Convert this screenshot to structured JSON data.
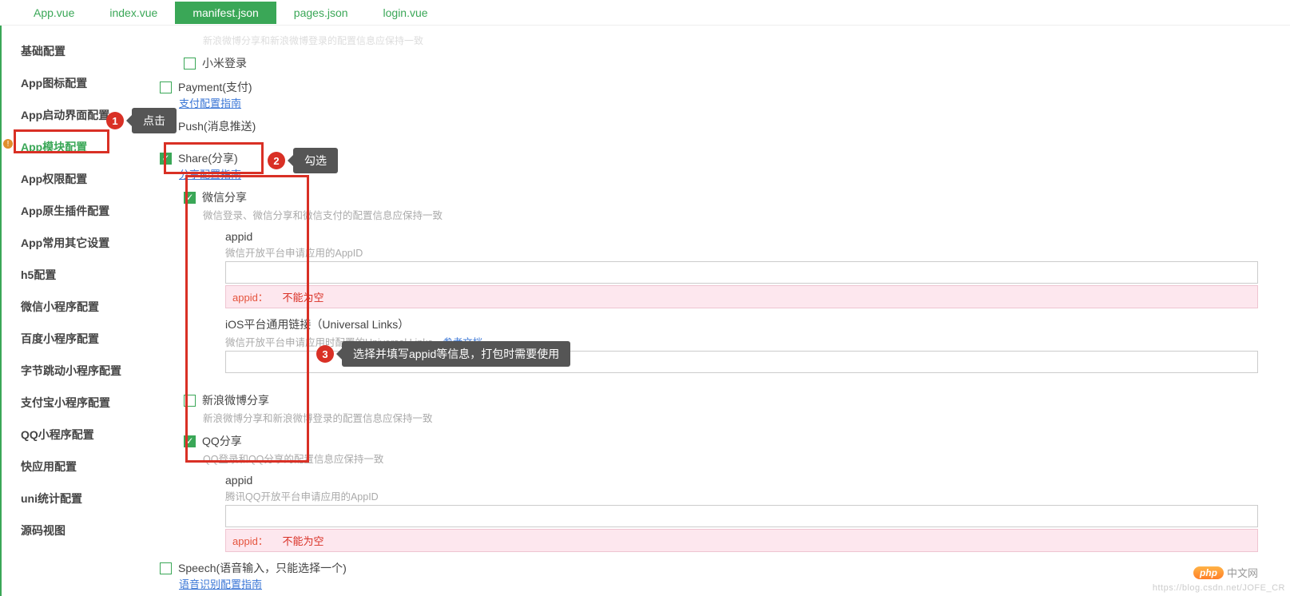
{
  "tabs": [
    {
      "label": "App.vue"
    },
    {
      "label": "index.vue"
    },
    {
      "label": "manifest.json",
      "active": true
    },
    {
      "label": "pages.json"
    },
    {
      "label": "login.vue"
    }
  ],
  "sidebar": {
    "items": [
      {
        "label": "基础配置"
      },
      {
        "label": "App图标配置"
      },
      {
        "label": "App启动界面配置"
      },
      {
        "label": "App模块配置",
        "active": true
      },
      {
        "label": "App权限配置"
      },
      {
        "label": "App原生插件配置"
      },
      {
        "label": "App常用其它设置"
      },
      {
        "label": "h5配置"
      },
      {
        "label": "微信小程序配置"
      },
      {
        "label": "百度小程序配置"
      },
      {
        "label": "字节跳动小程序配置"
      },
      {
        "label": "支付宝小程序配置"
      },
      {
        "label": "QQ小程序配置"
      },
      {
        "label": "快应用配置"
      },
      {
        "label": "uni统计配置"
      },
      {
        "label": "源码视图"
      }
    ]
  },
  "content": {
    "top_faded": "新浪微博分享和新浪微博登录的配置信息应保持一致",
    "xiaomi": {
      "label": "小米登录"
    },
    "payment": {
      "label": "Payment(支付)",
      "link": "支付配置指南"
    },
    "push": {
      "label": "Push(消息推送)"
    },
    "share": {
      "label": "Share(分享)",
      "link": "分享配置指南",
      "sub": {
        "wechat": {
          "label": "微信分享",
          "desc": "微信登录、微信分享和微信支付的配置信息应保持一致",
          "appid_label": "appid",
          "appid_hint": "微信开放平台申请应用的AppID",
          "error_code": "appid：",
          "error_msg": "不能为空",
          "ulink_label": "iOS平台通用链接（Universal Links）",
          "ulink_hint_prefix": "微信开放平台申请应用时配置的Universal Links，",
          "ulink_hint_link": "参考文档"
        },
        "weibo": {
          "label": "新浪微博分享",
          "desc": "新浪微博分享和新浪微博登录的配置信息应保持一致"
        },
        "qq": {
          "label": "QQ分享",
          "desc": "QQ登录和QQ分享的配置信息应保持一致",
          "appid_label": "appid",
          "appid_hint": "腾讯QQ开放平台申请应用的AppID",
          "error_code": "appid：",
          "error_msg": "不能为空"
        }
      }
    },
    "speech": {
      "label": "Speech(语音输入，只能选择一个)",
      "link": "语音识别配置指南"
    }
  },
  "annotations": {
    "a1": "点击",
    "a2": "勾选",
    "a3": "选择并填写appid等信息，打包时需要使用"
  },
  "footer": {
    "php_cn": "中文网",
    "watermark": "https://blog.csdn.net/JOFE_CR"
  }
}
